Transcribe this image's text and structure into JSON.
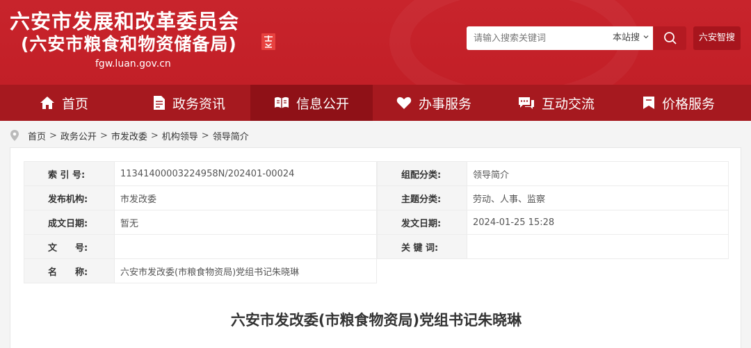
{
  "header": {
    "title_main": "六安市发展和改革委员会",
    "title_sub": "(六安市粮食和物资储备局)",
    "domain": "fgw.luan.gov.cn",
    "search": {
      "placeholder": "请输入搜索关键词",
      "scope_label": "本站搜"
    },
    "smart_search_label": "六安智搜"
  },
  "nav": {
    "items": [
      {
        "label": "首页",
        "icon": "home-icon"
      },
      {
        "label": "政务资讯",
        "icon": "document-icon"
      },
      {
        "label": "信息公开",
        "icon": "book-icon"
      },
      {
        "label": "办事服务",
        "icon": "heart-hands-icon"
      },
      {
        "label": "互动交流",
        "icon": "chat-icon"
      },
      {
        "label": "价格服务",
        "icon": "bookmark-icon"
      }
    ],
    "active_index": 2
  },
  "breadcrumb": {
    "items": [
      "首页",
      "政务公开",
      "市发改委",
      "机构领导",
      "领导简介"
    ],
    "separator": ">"
  },
  "meta": {
    "index_no": {
      "label": "索 引 号:",
      "value": "11341400003224958N/202401-00024"
    },
    "category": {
      "label": "组配分类:",
      "value": "领导简介"
    },
    "publisher": {
      "label": "发布机构:",
      "value": "市发改委"
    },
    "topic": {
      "label": "主题分类:",
      "value": "劳动、人事、监察"
    },
    "created": {
      "label": "成文日期:",
      "value": "暂无"
    },
    "published": {
      "label": "发文日期:",
      "value": "2024-01-25 15:28"
    },
    "doc_no": {
      "label": "文　　号:",
      "value": ""
    },
    "keywords": {
      "label": "关 键 词:",
      "value": ""
    },
    "name": {
      "label": "名　　称:",
      "value": "六安市发改委(市粮食物资局)党组书记朱晓琳"
    }
  },
  "article": {
    "title": "六安市发改委(市粮食物资局)党组书记朱晓琳"
  },
  "colors": {
    "header_red": "#c8242c",
    "nav_red": "#a6191f",
    "nav_active": "#8f1117"
  }
}
